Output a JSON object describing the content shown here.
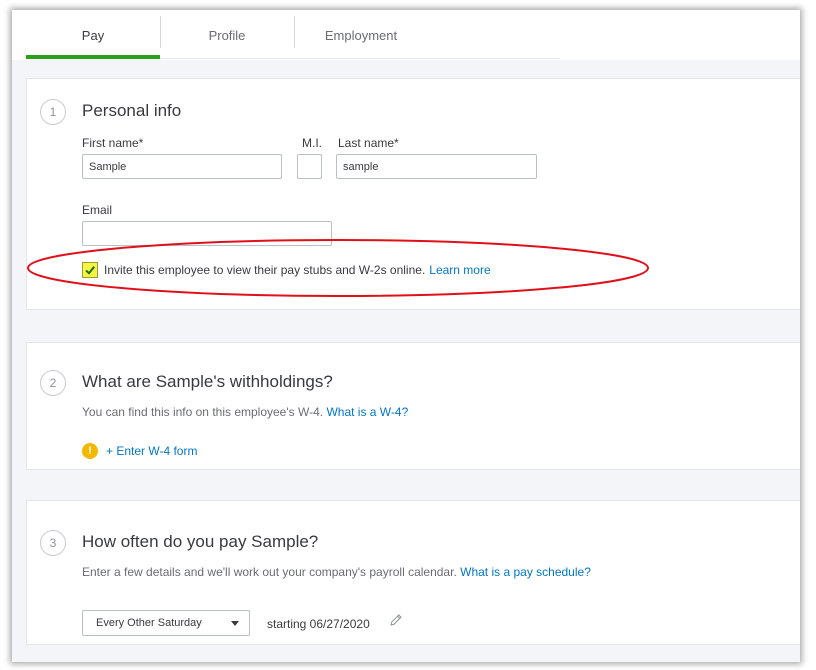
{
  "tabs": [
    {
      "label": "Pay",
      "active": true
    },
    {
      "label": "Profile",
      "active": false
    },
    {
      "label": "Employment",
      "active": false
    }
  ],
  "personal": {
    "step": "1",
    "title": "Personal info",
    "first_name_label": "First name*",
    "first_name_value": "Sample",
    "mi_label": "M.I.",
    "mi_value": "",
    "last_name_label": "Last name*",
    "last_name_value": "sample",
    "email_label": "Email",
    "email_value": "",
    "invite_checked": true,
    "invite_text": "Invite this employee to view their pay stubs and W-2s online.",
    "learn_more": "Learn more"
  },
  "withholdings": {
    "step": "2",
    "title": "What are Sample's withholdings?",
    "subtitle": "You can find this info on this employee's W-4.",
    "subtitle_link": "What is a W-4?",
    "warn_symbol": "!",
    "enter_w4": "+ Enter W-4 form"
  },
  "pay_schedule": {
    "step": "3",
    "title": "How often do you pay Sample?",
    "subtitle": "Enter a few details and we'll work out your company's payroll calendar.",
    "subtitle_link": "What is a pay schedule?",
    "frequency": "Every Other Saturday",
    "starting": "starting 06/27/2020"
  },
  "colors": {
    "accent_green": "#2ca01c",
    "link_blue": "#0077c5",
    "highlight_yellow": "#f5f542",
    "annotation_red": "#e0101a",
    "warning": "#f5b800"
  },
  "icons": {
    "checkbox": "check-icon",
    "warning": "exclamation-icon",
    "dropdown": "caret-down-icon",
    "edit": "pencil-icon"
  }
}
